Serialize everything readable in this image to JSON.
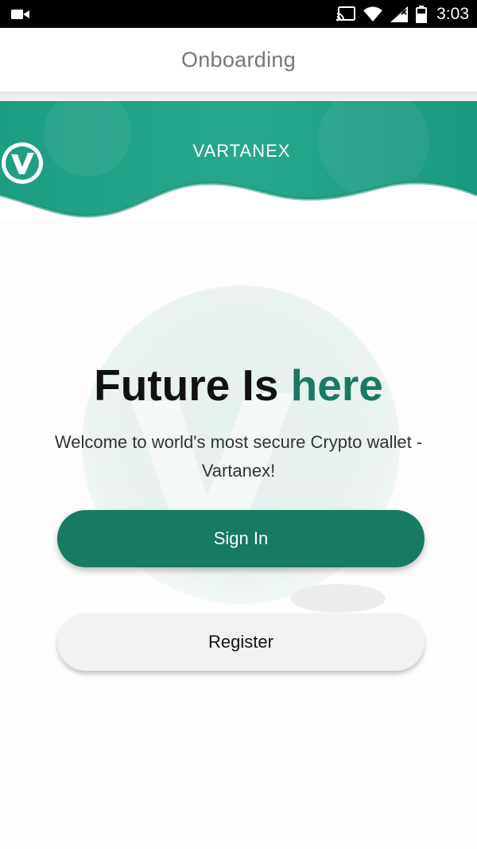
{
  "status_bar": {
    "time": "3:03",
    "icons": [
      "video-camera-icon",
      "cast-icon",
      "wifi-icon",
      "cellular-signal-icon",
      "battery-icon"
    ]
  },
  "app_bar": {
    "title": "Onboarding"
  },
  "banner": {
    "brand_name": "VARTANEX",
    "logo_icon": "vartanex-logo-icon"
  },
  "hero": {
    "headline_part1": "Future Is ",
    "headline_accent": "here",
    "subtitle": "Welcome to world's most secure Crypto wallet - Vartanex!"
  },
  "actions": {
    "sign_in_label": "Sign In",
    "register_label": "Register"
  },
  "colors": {
    "brand_green": "#177a62",
    "accent_text": "#187a63",
    "banner_teal": "#1f9c82"
  }
}
